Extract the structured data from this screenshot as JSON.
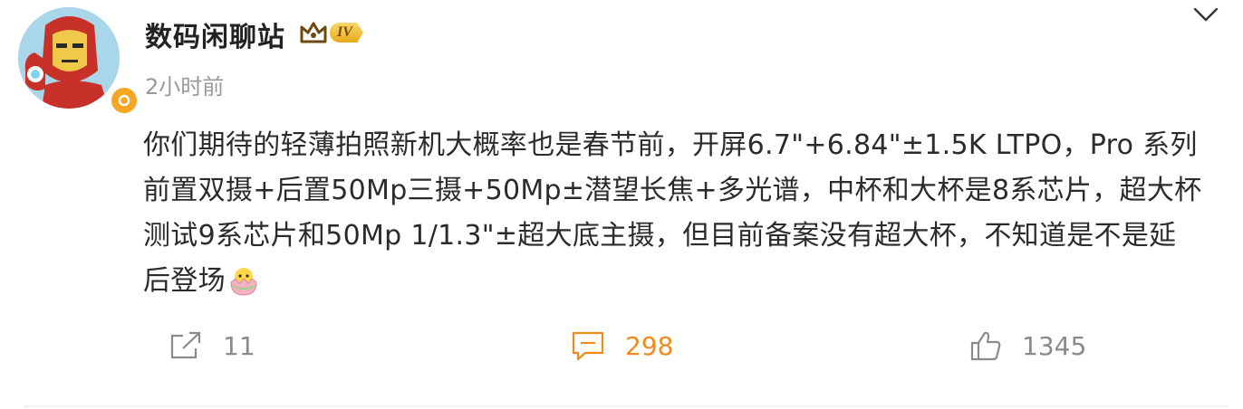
{
  "post": {
    "author": {
      "name": "数码闲聊站",
      "vip_level": "IV",
      "verified_color": "#f6a623",
      "avatar_icon": "iron-man-avatar"
    },
    "time": "2小时前",
    "content": "你们期待的轻薄拍照新机大概率也是春节前，开屏6.7\"+6.84\"±1.5K LTPO，Pro 系列前置双摄+后置50Mp三摄+50Mp±潜望长焦+多光谱，中杯和大杯是8系芯片，超大杯测试9系芯片和50Mp 1/1.3\"±超大底主摄，但目前备案没有超大杯，不知道是不是延后登场",
    "content_emoji": "hatching-chick-emoji"
  },
  "actions": {
    "repost_count": "11",
    "comment_count": "298",
    "like_count": "1345",
    "comment_color": "#f08a1d"
  }
}
